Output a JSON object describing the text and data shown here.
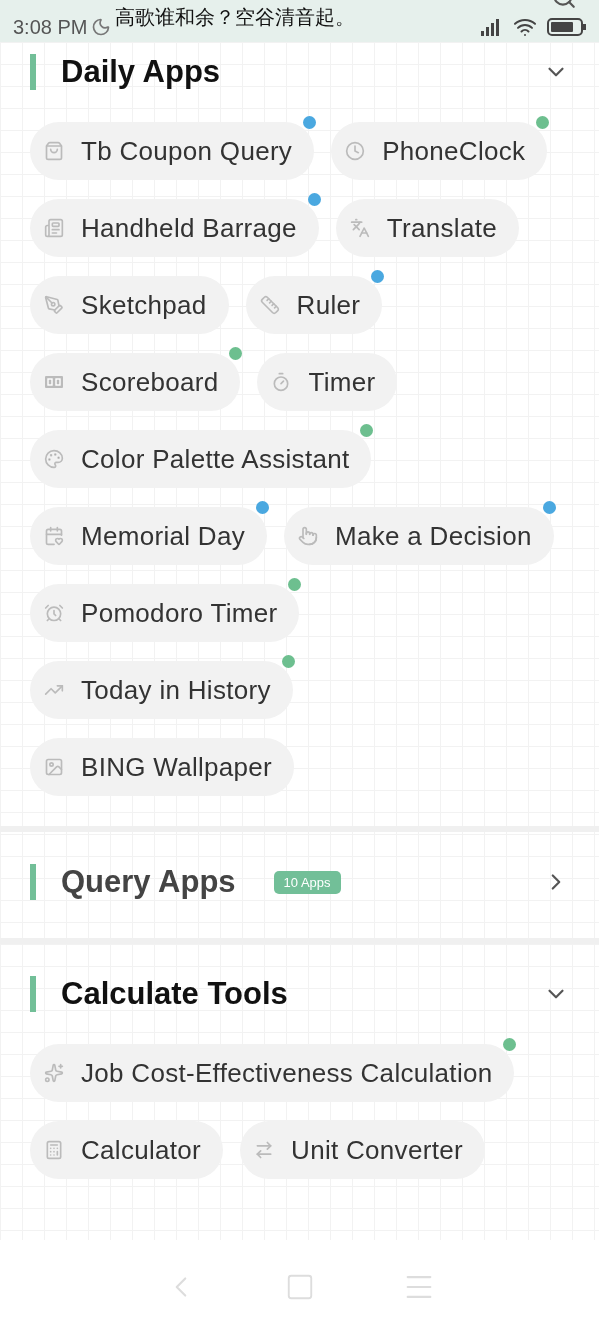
{
  "status_bar": {
    "time": "3:08 PM",
    "notification": "高歌谁和余？空谷清音起。"
  },
  "sections": [
    {
      "title": "Daily Apps",
      "expanded": true,
      "apps": [
        {
          "label": "Tb Coupon Query",
          "color": "#4aa8e0"
        },
        {
          "label": "PhoneClock",
          "color": "#6dbf8f"
        },
        {
          "label": "Handheld Barrage",
          "color": "#4aa8e0"
        },
        {
          "label": "Translate"
        },
        {
          "label": "Sketchpad"
        },
        {
          "label": "Ruler",
          "color": "#4aa8e0"
        },
        {
          "label": "Scoreboard",
          "color": "#6dbf8f"
        },
        {
          "label": "Timer"
        },
        {
          "label": "Color Palette Assistant",
          "color": "#6dbf8f"
        },
        {
          "label": "Memorial Day",
          "color": "#4aa8e0"
        },
        {
          "label": "Make a Decision",
          "color": "#4aa8e0"
        },
        {
          "label": "Pomodoro Timer",
          "color": "#6dbf8f"
        },
        {
          "label": "Today in History",
          "color": "#6dbf8f"
        },
        {
          "label": "BING Wallpaper"
        }
      ]
    },
    {
      "title": "Query Apps",
      "expanded": false,
      "badge": "10 Apps"
    },
    {
      "title": "Calculate Tools",
      "expanded": true,
      "apps": [
        {
          "label": "Job Cost-Effectiveness Calculation",
          "color": "#6dbf8f"
        },
        {
          "label": "Calculator"
        },
        {
          "label": "Unit Converter"
        }
      ]
    }
  ]
}
